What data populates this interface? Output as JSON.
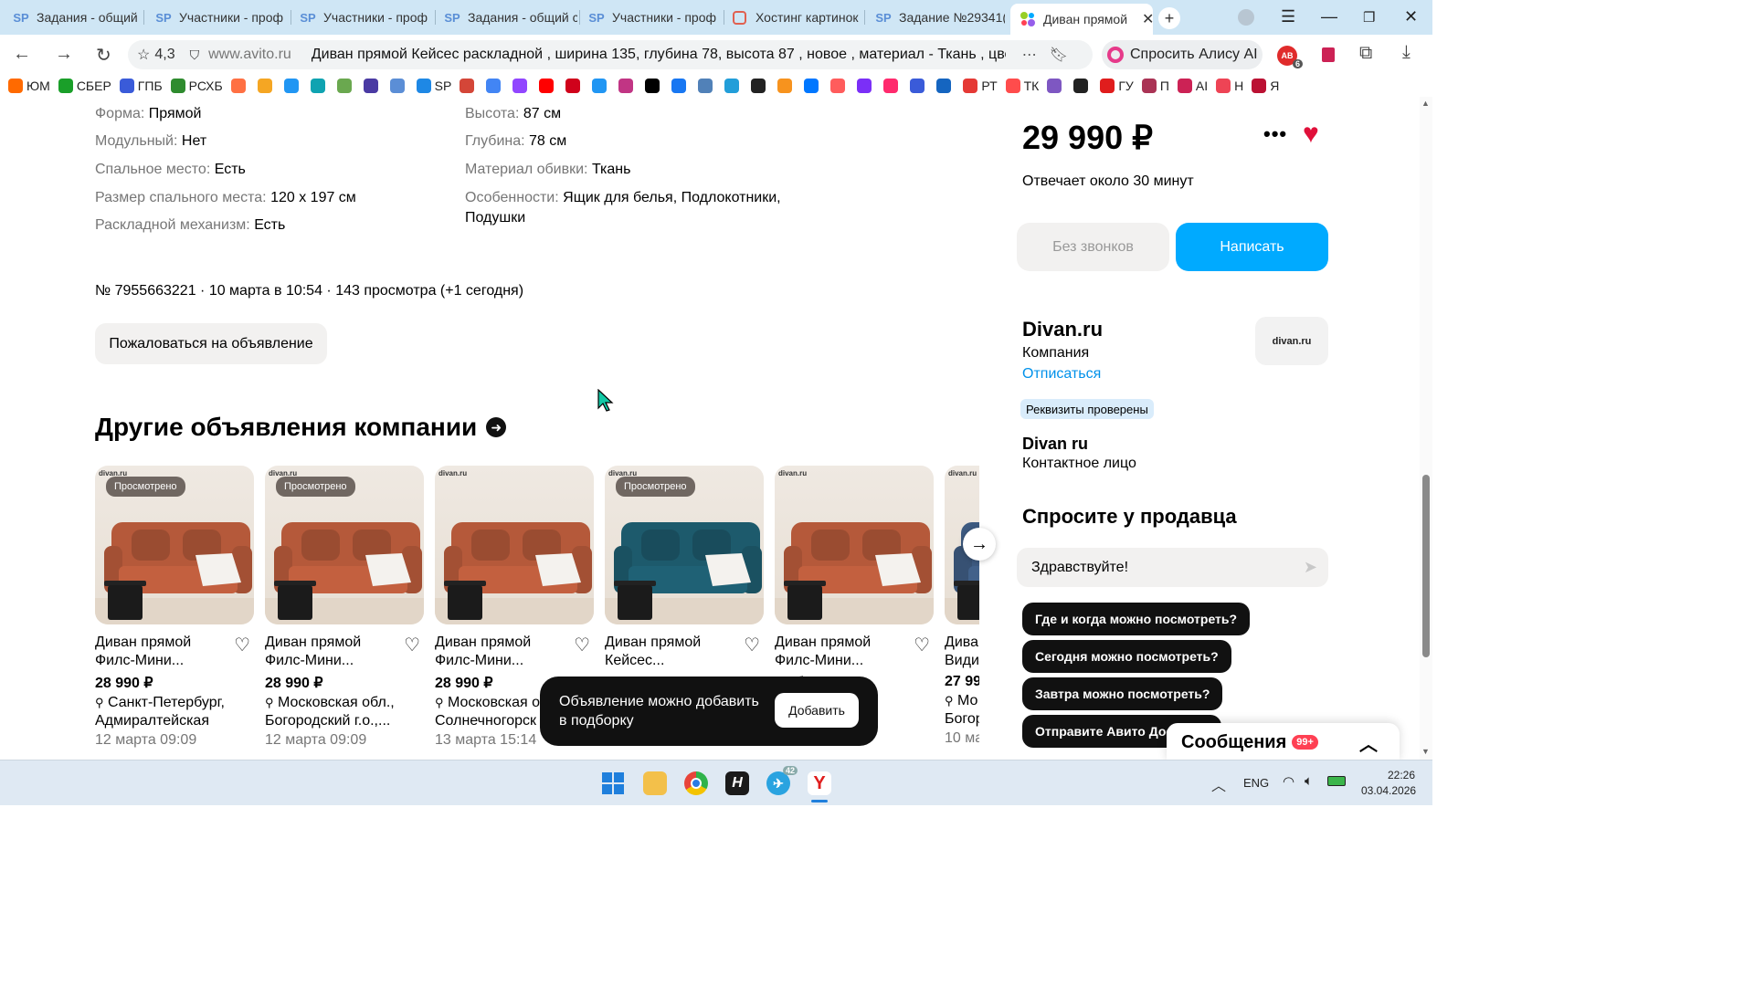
{
  "browser": {
    "tabs": [
      {
        "label": "Задания - общий с",
        "icon": "SP"
      },
      {
        "label": "Участники - проф",
        "icon": "SP"
      },
      {
        "label": "Участники - проф",
        "icon": "SP"
      },
      {
        "label": "Задания - общий с",
        "icon": "SP"
      },
      {
        "label": "Участники - проф",
        "icon": "SP"
      },
      {
        "label": "Хостинг картинок",
        "icon": "image-host-icon"
      },
      {
        "label": "Задание №29341(",
        "icon": "SP"
      },
      {
        "label": "Диван прямой",
        "icon": "avito-icon"
      }
    ],
    "rating": "4,3",
    "url_domain": "www.avito.ru",
    "page_title": "Диван прямой Кейсес раскладной , ширина 135, глубина 78, высота 87 , новое , материал - Ткань , цвет Б...",
    "alice_label": "Спросить Алису AI",
    "ext_badge": "6",
    "bookmarks": [
      "ЮМ",
      "СБЕР",
      "ГПБ",
      "РСХБ",
      "",
      "",
      "",
      "",
      "",
      "",
      "",
      "SP",
      "",
      "",
      "",
      "",
      "",
      "",
      "",
      "",
      "",
      "",
      "",
      "",
      "",
      "",
      "",
      "",
      "",
      "",
      "",
      "РТ",
      "ТК",
      "",
      "",
      "ГУ",
      "П",
      "AI",
      "Н",
      "Я"
    ]
  },
  "properties_left": [
    {
      "key": "Форма:",
      "value": "Прямой"
    },
    {
      "key": "Модульный:",
      "value": "Нет"
    },
    {
      "key": "Спальное место:",
      "value": "Есть"
    },
    {
      "key": "Размер спального места:",
      "value": "120 х 197 см"
    },
    {
      "key": "Раскладной механизм:",
      "value": "Есть"
    }
  ],
  "properties_right": [
    {
      "key": "Высота:",
      "value": "87 см"
    },
    {
      "key": "Глубина:",
      "value": "78 см"
    },
    {
      "key": "Материал обивки:",
      "value": "Ткань"
    },
    {
      "key": "Особенности:",
      "value": "Ящик для белья, Подлокотники,",
      "value2": "Подушки"
    }
  ],
  "listing_meta": "№ 7955663221 · 10 марта в 10:54 · 143 просмотра (+1 сегодня)",
  "complain_button": "Пожаловаться на объявление",
  "other_heading": "Другие объявления компании",
  "cards": [
    {
      "badge": "Просмотрено",
      "title1": "Диван прямой",
      "title2": "Филс-Мини...",
      "price": "28 990 ₽",
      "loc1": "Санкт-Петербург,",
      "loc2": "Адмиралтейская",
      "date": "12 марта 09:09",
      "color": "#b5593a"
    },
    {
      "badge": "Просмотрено",
      "title1": "Диван прямой",
      "title2": "Филс-Мини...",
      "price": "28 990 ₽",
      "loc1": "Московская обл.,",
      "loc2": "Богородский г.о.,...",
      "date": "12 марта 09:09",
      "color": "#b5593a"
    },
    {
      "badge": "",
      "title1": "Диван прямой",
      "title2": "Филс-Мини...",
      "price": "28 990 ₽",
      "loc1": "Московская о",
      "loc2": "Солнечногорск",
      "date": "13 марта 15:14",
      "color": "#b5593a"
    },
    {
      "badge": "Просмотрено",
      "title1": "Диван прямой",
      "title2": "Кейсес...",
      "price": "",
      "loc1": "",
      "loc2": "",
      "date": "",
      "color": "#1d5a6c"
    },
    {
      "badge": "",
      "title1": "Диван прямой",
      "title2": "Филс-Мини...",
      "price": "",
      "loc1": "обл.,",
      "loc2": "дх",
      "date": "",
      "color": "#b5593a"
    },
    {
      "badge": "",
      "title1": "Дива",
      "title2": "Види",
      "price": "27 99",
      "loc1": "Мо",
      "loc2": "Богор",
      "date": "10 ма",
      "color": "#3d5a80"
    }
  ],
  "toast": {
    "text1": "Объявление можно добавить",
    "text2": "в подборку",
    "button": "Добавить"
  },
  "sidebar": {
    "price": "29 990 ₽",
    "response": "Отвечает около 30 минут",
    "no_calls": "Без звонков",
    "write": "Написать",
    "seller_name": "Divan.ru",
    "seller_type": "Компания",
    "unsubscribe": "Отписаться",
    "verified": "Реквизиты проверены",
    "logo_text": "divan.ru",
    "contact_name": "Divan ru",
    "contact_role": "Контактное лицо",
    "ask_heading": "Спросите у продавца",
    "message_value": "Здравствуйте!",
    "questions": [
      "Где и когда можно посмотреть?",
      "Сегодня можно посмотреть?",
      "Завтра можно посмотреть?",
      "Отправите Авито Дост"
    ],
    "messages_label": "Сообщения",
    "messages_badge": "99+"
  },
  "taskbar": {
    "telegram_badge": "42",
    "lang": "ENG",
    "time": "22:26",
    "date": "03.04.2026"
  },
  "colors": {
    "accent": "#00aaff",
    "heart": "#e0103a",
    "link": "#0091ea"
  }
}
